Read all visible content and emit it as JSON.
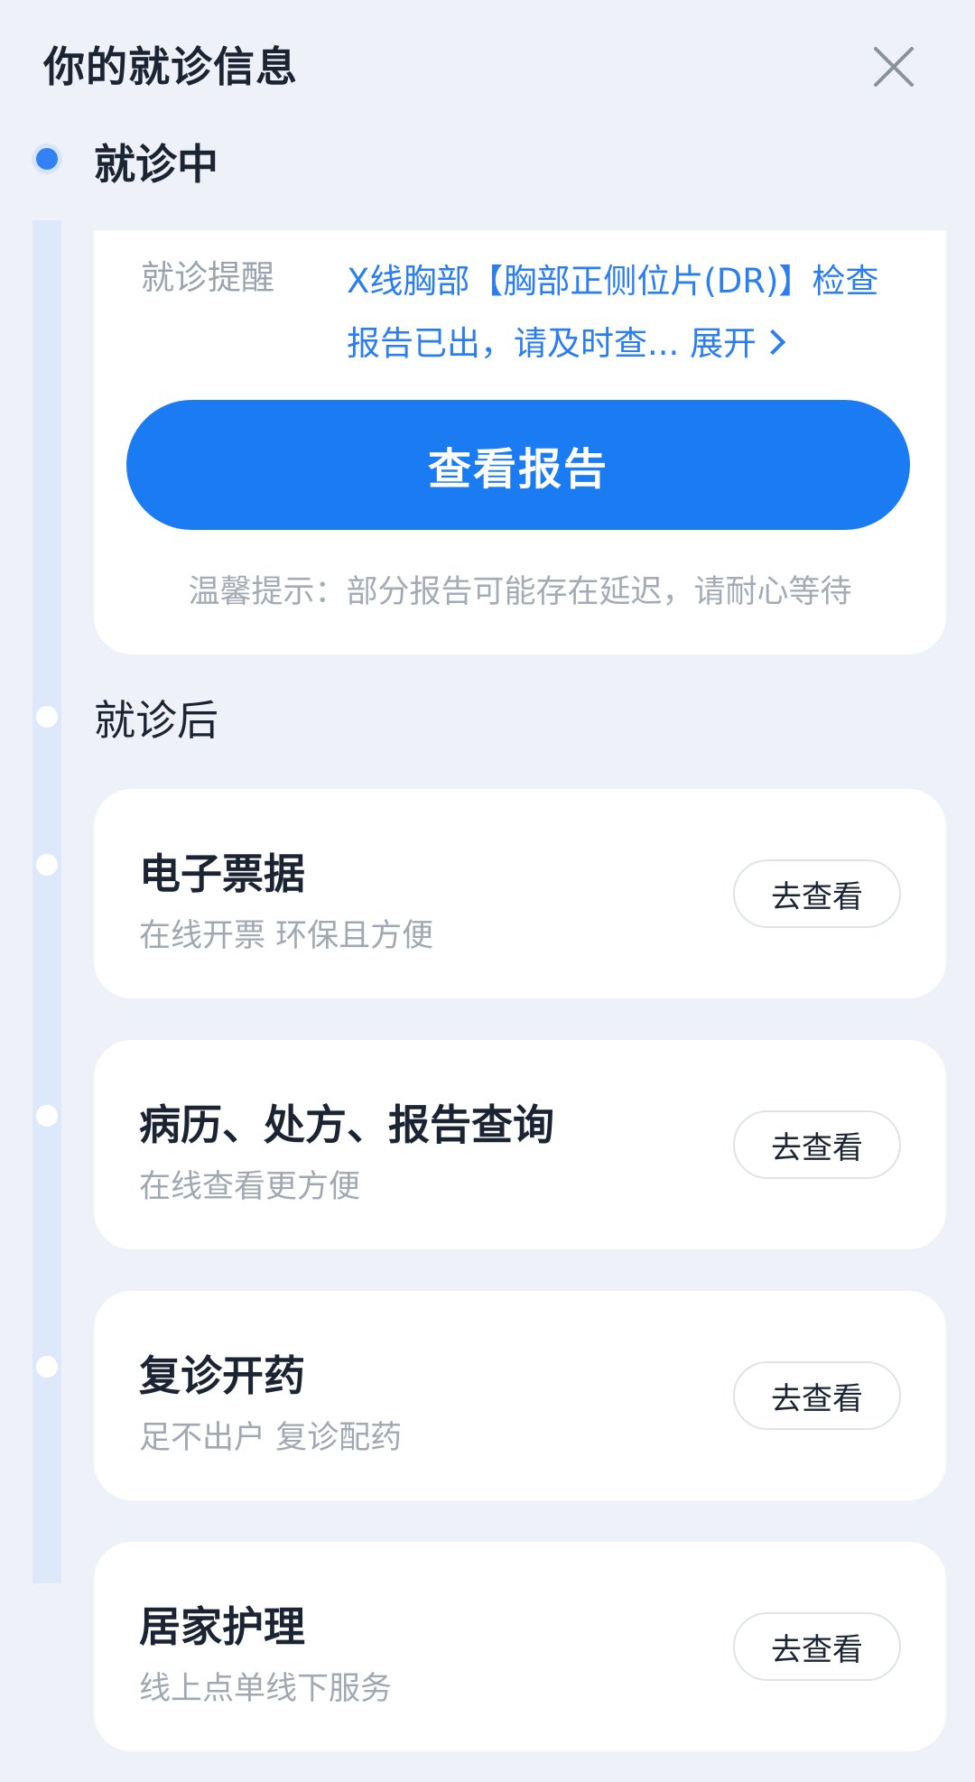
{
  "header": {
    "title": "你的就诊信息",
    "close_icon": "close-icon"
  },
  "timeline": {
    "active_color": "#3381f4"
  },
  "current_stage": {
    "label": "就诊中",
    "reminder_label": "就诊提醒",
    "reminder_text": "X线胸部【胸部正侧位片(DR)】检查报告已出，请及时查...",
    "expand_label": "展开",
    "primary_button": "查看报告",
    "tip": "温馨提示：部分报告可能存在延迟，请耐心等待"
  },
  "after_stage": {
    "label": "就诊后",
    "items": [
      {
        "title": "电子票据",
        "subtitle": "在线开票 环保且方便",
        "button": "去查看"
      },
      {
        "title": "病历、处方、报告查询",
        "subtitle": "在线查看更方便",
        "button": "去查看"
      },
      {
        "title": "复诊开药",
        "subtitle": "足不出户 复诊配药",
        "button": "去查看"
      },
      {
        "title": "居家护理",
        "subtitle": "线上点单线下服务",
        "button": "去查看"
      }
    ]
  },
  "colors": {
    "accent": "#1a7bf2",
    "background": "#eef1f7"
  }
}
